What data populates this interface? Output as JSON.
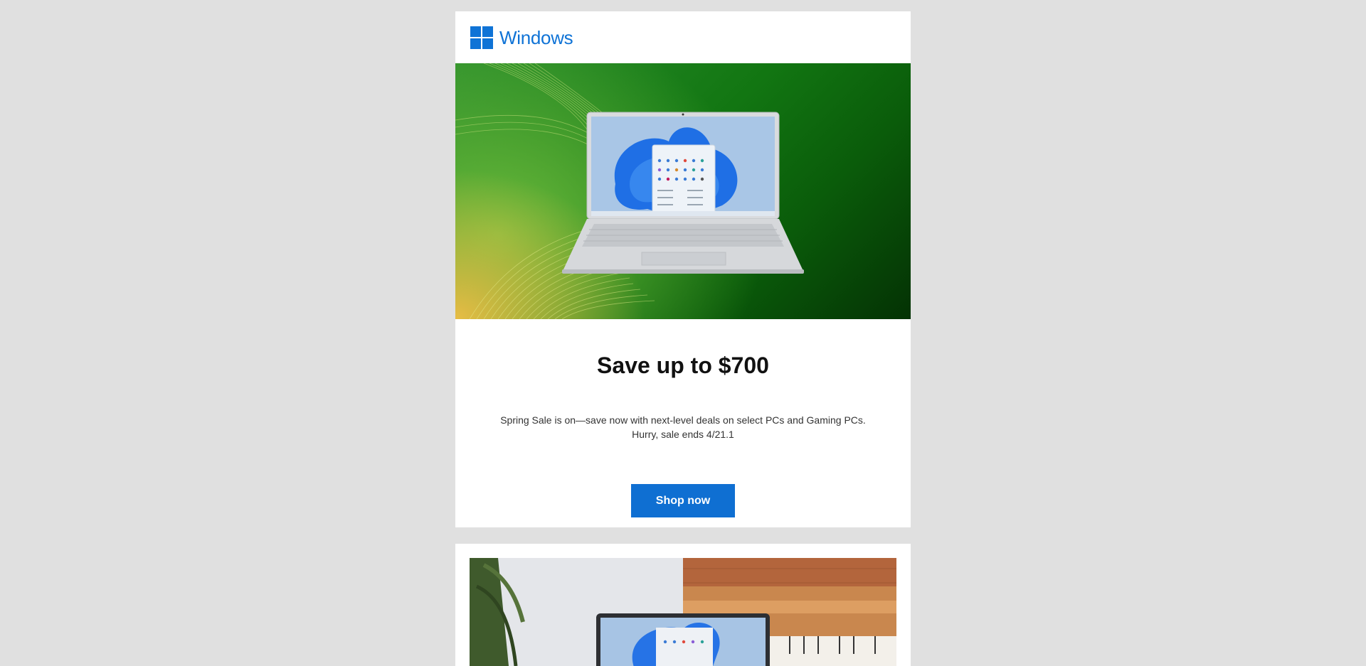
{
  "brand": {
    "logo_text": "Windows",
    "color": "#0f73d6"
  },
  "hero": {
    "image_description_icon": "laptop-icon",
    "colors": {
      "primary_green": "#127612",
      "dark_green": "#043204",
      "accent_gold": "#f0be46"
    }
  },
  "promo": {
    "headline": "Save up to $700",
    "body_line1": "Spring Sale is on—save now with next-level deals on select PCs and Gaming PCs.",
    "body_line2": "Hurry, sale ends 4/21.1",
    "cta_label": "Shop now",
    "cta_color": "#0f6fd2"
  },
  "page": {
    "background": "#e0e0e0"
  }
}
